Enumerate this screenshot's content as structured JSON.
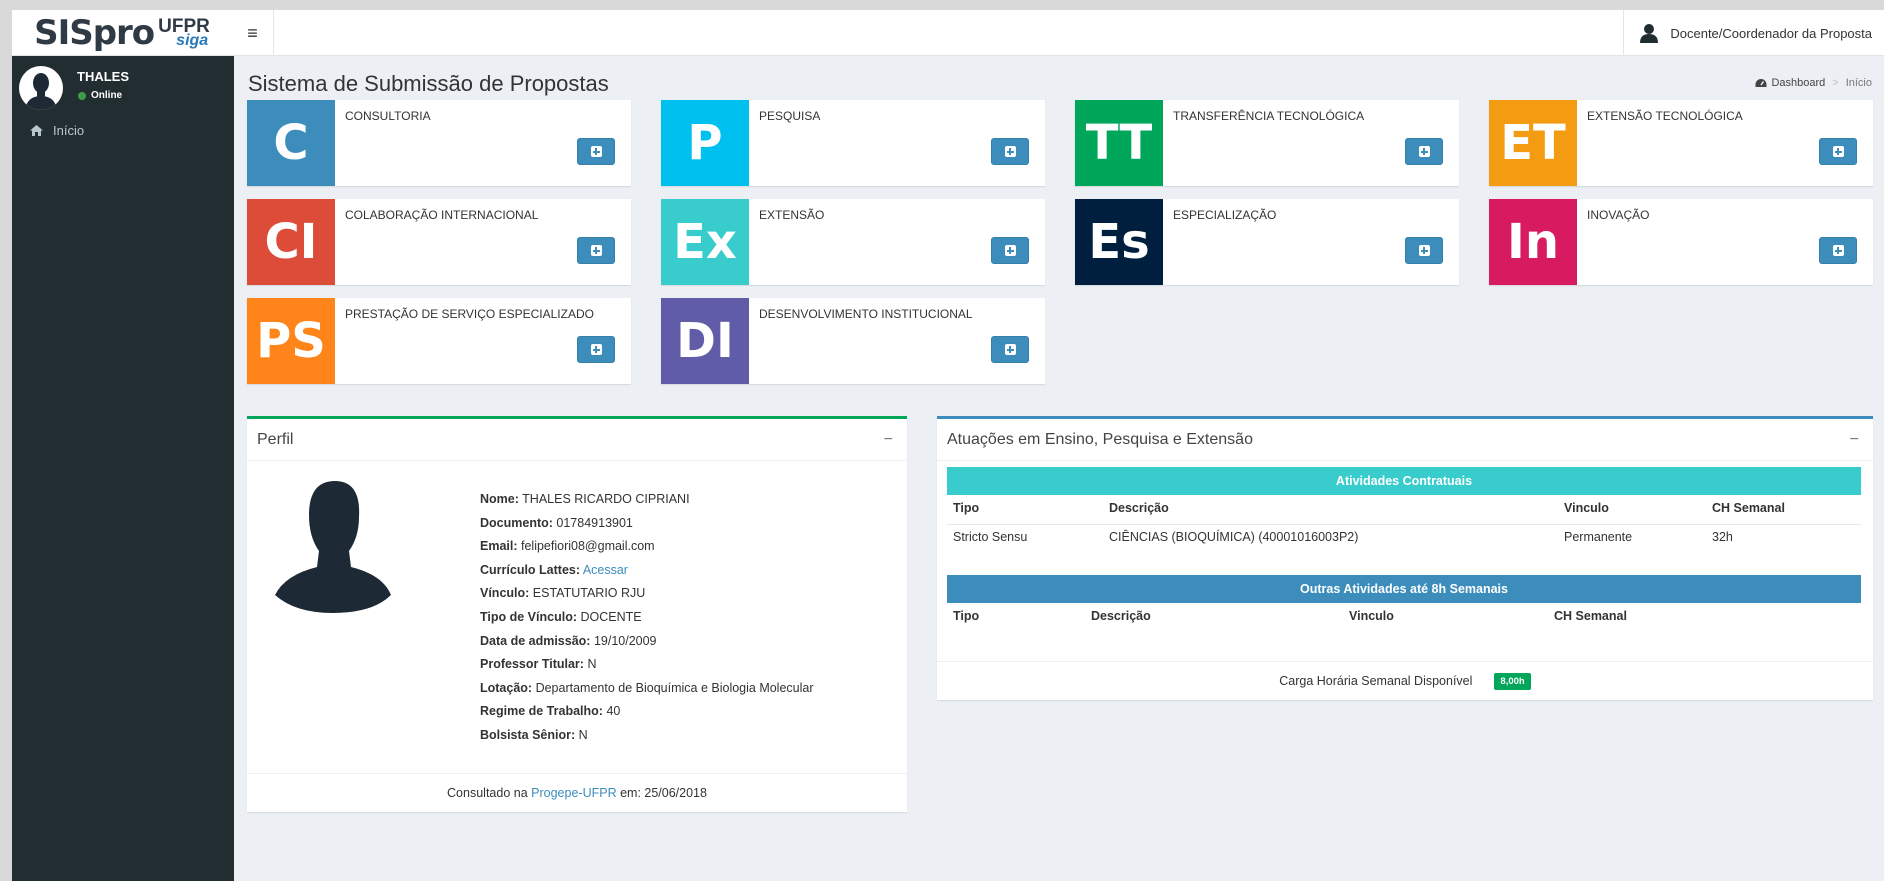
{
  "header": {
    "logo_main": "SISpro",
    "logo_ufpr": "UFPR",
    "logo_siga": "siga",
    "toggle_glyph": "≡",
    "user_label": "Docente/Coordenador da Proposta"
  },
  "sidebar": {
    "user_name": "THALES",
    "user_status": "Online",
    "menu": [
      {
        "label": "Início",
        "icon": "home-icon"
      }
    ]
  },
  "page": {
    "title": "Sistema de Submissão de Propostas",
    "breadcrumb": {
      "dashboard": "Dashboard",
      "current": "Início"
    }
  },
  "tiles": [
    {
      "abbr": "C",
      "label": "CONSULTORIA",
      "color": "#3c8dbc"
    },
    {
      "abbr": "P",
      "label": "PESQUISA",
      "color": "#00c0ef"
    },
    {
      "abbr": "TT",
      "label": "TRANSFERÊNCIA TECNOLÓGICA",
      "color": "#00a65a"
    },
    {
      "abbr": "ET",
      "label": "EXTENSÃO TECNOLÓGICA",
      "color": "#f39c12"
    },
    {
      "abbr": "CI",
      "label": "COLABORAÇÃO INTERNACIONAL",
      "color": "#dd4b39"
    },
    {
      "abbr": "Ex",
      "label": "EXTENSÃO",
      "color": "#39cccc"
    },
    {
      "abbr": "Es",
      "label": "ESPECIALIZAÇÃO",
      "color": "#001f3f"
    },
    {
      "abbr": "In",
      "label": "INOVAÇÃO",
      "color": "#d81b60"
    },
    {
      "abbr": "PS",
      "label": "PRESTAÇÃO DE SERVIÇO ESPECIALIZADO",
      "color": "#ff851b"
    },
    {
      "abbr": "DI",
      "label": "DESENVOLVIMENTO INSTITUCIONAL",
      "color": "#605ca8"
    }
  ],
  "perfil": {
    "title": "Perfil",
    "collapse": "−",
    "fields": [
      {
        "label": "Nome:",
        "value": "THALES RICARDO CIPRIANI"
      },
      {
        "label": "Documento:",
        "value": "01784913901"
      },
      {
        "label": "Email:",
        "value": "felipefiori08@gmail.com"
      },
      {
        "label": "Currículo Lattes:",
        "value": "Acessar",
        "link": true
      },
      {
        "label": "Vínculo:",
        "value": "ESTATUTARIO RJU"
      },
      {
        "label": "Tipo de Vínculo:",
        "value": "DOCENTE"
      },
      {
        "label": "Data de admissão:",
        "value": "19/10/2009"
      },
      {
        "label": "Professor Titular:",
        "value": "N"
      },
      {
        "label": "Lotação:",
        "value": "Departamento de Bioquímica e Biologia Molecular"
      },
      {
        "label": "Regime de Trabalho:",
        "value": "40"
      },
      {
        "label": "Bolsista Sênior:",
        "value": "N"
      }
    ],
    "footer": {
      "prefix": "Consultado na",
      "link": "Progepe-UFPR",
      "suffix": "em: 25/06/2018"
    }
  },
  "atuacoes": {
    "title": "Atuações em Ensino, Pesquisa e Extensão",
    "collapse": "−",
    "contratuais": {
      "title": "Atividades Contratuais",
      "color": "#39cccc",
      "headers": [
        "Tipo",
        "Descrição",
        "Vinculo",
        "CH Semanal"
      ],
      "rows": [
        [
          "Stricto Sensu",
          "CIÊNCIAS (BIOQUÍMICA) (40001016003P2)",
          "Permanente",
          "32h"
        ]
      ]
    },
    "outras": {
      "title": "Outras Atividades até 8h Semanais",
      "color": "#3c8dbc",
      "headers": [
        "Tipo",
        "Descrição",
        "Vinculo",
        "CH Semanal"
      ]
    },
    "carga": {
      "label": "Carga Horária Semanal Disponível",
      "value": "8,00h"
    }
  }
}
